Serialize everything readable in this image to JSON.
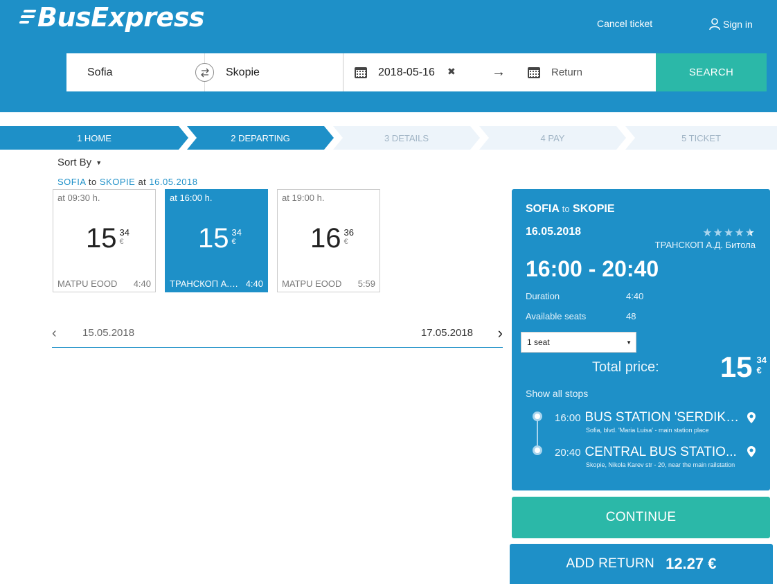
{
  "brand": {
    "name": "BusExpress"
  },
  "topnav": {
    "cancel_ticket": "Cancel ticket",
    "sign_in": "Sign in"
  },
  "search": {
    "from": "Sofia",
    "to": "Skopie",
    "depart_date": "2018-05-16",
    "return_placeholder": "Return",
    "search_label": "SEARCH"
  },
  "steps": [
    {
      "label": "1 HOME",
      "state": "done"
    },
    {
      "label": "2 DEPARTING",
      "state": "active"
    },
    {
      "label": "3 DETAILS",
      "state": "inactive"
    },
    {
      "label": "4 PAY",
      "state": "inactive"
    },
    {
      "label": "5 TICKET",
      "state": "inactive"
    }
  ],
  "sort_by": "Sort By",
  "route": {
    "from": "SOFIA",
    "to_word": "to",
    "to": "SKOPIE",
    "at_word": "at",
    "date": "16.05.2018"
  },
  "departures": [
    {
      "time": "at 09:30 h.",
      "price_int": "15",
      "price_cents": "34",
      "currency": "€",
      "operator": "МАТРU EOOD",
      "duration": "4:40",
      "selected": false
    },
    {
      "time": "at 16:00 h.",
      "price_int": "15",
      "price_cents": "34",
      "currency": "€",
      "operator": "ТРАНСКОП А.Д. Битола",
      "duration": "4:40",
      "selected": true
    },
    {
      "time": "at 19:00 h.",
      "price_int": "16",
      "price_cents": "36",
      "currency": "€",
      "operator": "МАТРU EOOD",
      "duration": "5:59",
      "selected": false
    }
  ],
  "date_nav": {
    "prev": "15.05.2018",
    "next": "17.05.2018"
  },
  "details": {
    "from": "SOFIA",
    "to_word": "to",
    "to": "SKOPIE",
    "date": "16.05.2018",
    "rating": 4.5,
    "operator": "ТРАНСКОП А.Д. Битола",
    "times": "16:00 - 20:40",
    "duration_label": "Duration",
    "duration": "4:40",
    "seats_label": "Available seats",
    "seats": "48",
    "seat_select": "1 seat",
    "total_label": "Total price:",
    "total_int": "15",
    "total_cents": "34",
    "currency": "€",
    "show_stops": "Show all stops",
    "stops": [
      {
        "time": "16:00",
        "name": "BUS STATION 'SERDIKA...",
        "address": "Sofia, blvd. 'Maria Luisa' - main station place"
      },
      {
        "time": "20:40",
        "name": "CENTRAL BUS STATIO...",
        "address": "Skopie, Nikola Karev str - 20, near the main railstation"
      }
    ]
  },
  "continue_label": "CONTINUE",
  "add_return": {
    "label": "ADD RETURN",
    "amount": "12.27 €"
  },
  "colors": {
    "primary": "#1e90c8",
    "accent": "#2bb8a8",
    "step_inactive": "#edf4fa"
  }
}
